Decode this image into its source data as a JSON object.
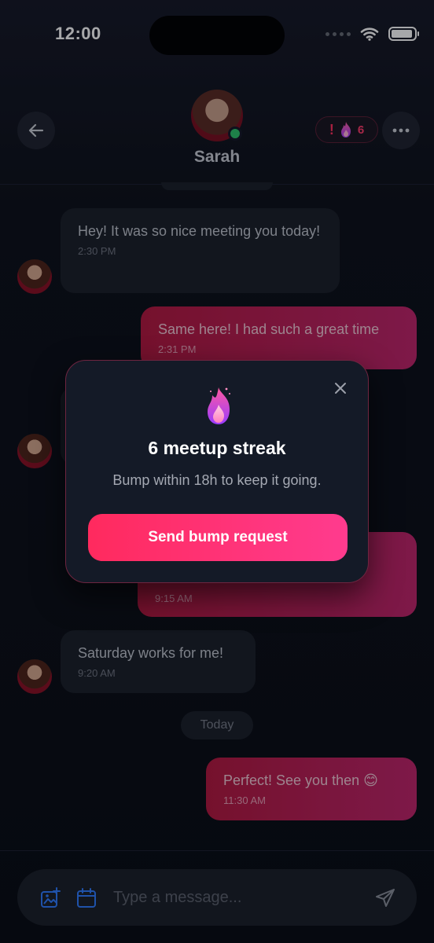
{
  "status_bar": {
    "time": "12:00"
  },
  "header": {
    "contact_name": "Sarah",
    "streak_badge": {
      "alert": "!",
      "count": "6"
    }
  },
  "messages": [
    {
      "direction": "in",
      "text": "Hey! It was so nice meeting you today!",
      "time": "2:30 PM"
    },
    {
      "direction": "out",
      "text": "Same here! I had such a great time",
      "time": "2:31 PM"
    },
    {
      "direction": "out",
      "text": "",
      "time": "9:15 AM"
    },
    {
      "direction": "in",
      "text": "Saturday works for me!",
      "time": "9:20 AM"
    },
    {
      "direction": "out",
      "text": "Perfect! See you then 😊",
      "time": "11:30 AM"
    }
  ],
  "day_separator": "Today",
  "streak_modal": {
    "title": "6 meetup streak",
    "subtitle": "Bump within 18h to keep it going.",
    "button_label": "Send bump request"
  },
  "composer": {
    "placeholder": "Type a message..."
  },
  "colors": {
    "accent": "#ff2d6f",
    "outgoing_bubble": "#b3183f",
    "incoming_bubble": "#1b1f28",
    "online": "#2dc46b",
    "icon_blue": "#2f7bff"
  },
  "icons": [
    "back-arrow-icon",
    "flame-icon",
    "more-dots-icon",
    "close-icon",
    "image-add-icon",
    "calendar-icon",
    "send-icon",
    "wifi-icon",
    "battery-icon",
    "signal-icon"
  ]
}
